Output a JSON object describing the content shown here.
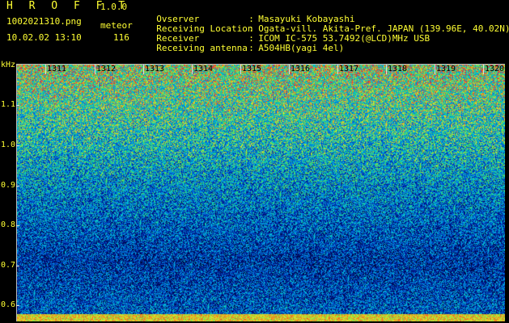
{
  "header": {
    "app_title": "H R O F F T",
    "version": "1.0.0",
    "filename": "1002021310.png",
    "mode": "meteor",
    "datetime": "10.02.02 13:10",
    "count": "116"
  },
  "info": [
    {
      "key": "Ovserver",
      "sep": ":",
      "value": "Masayuki Kobayashi"
    },
    {
      "key": "Receiving Location",
      "sep": ":",
      "value": "Ogata-vill. Akita-Pref. JAPAN (139.96E, 40.02N)"
    },
    {
      "key": "Receiver",
      "sep": ":",
      "value": "ICOM IC-575 53.7492(@LCD)MHz USB"
    },
    {
      "key": "Receiving antenna",
      "sep": ":",
      "value": "A504HB(yagi 4el)"
    }
  ],
  "axis": {
    "y_unit": "kHz",
    "y_ticks": [
      "1.1",
      "1.0",
      "0.9",
      "0.8",
      "0.7",
      "0.6"
    ],
    "x_ticks": [
      "1311",
      "1312",
      "1313",
      "1314",
      "1315",
      "1316",
      "1317",
      "1318",
      "1319",
      "1320"
    ]
  },
  "colors": {
    "text": "#ffff33",
    "background": "#000000"
  }
}
